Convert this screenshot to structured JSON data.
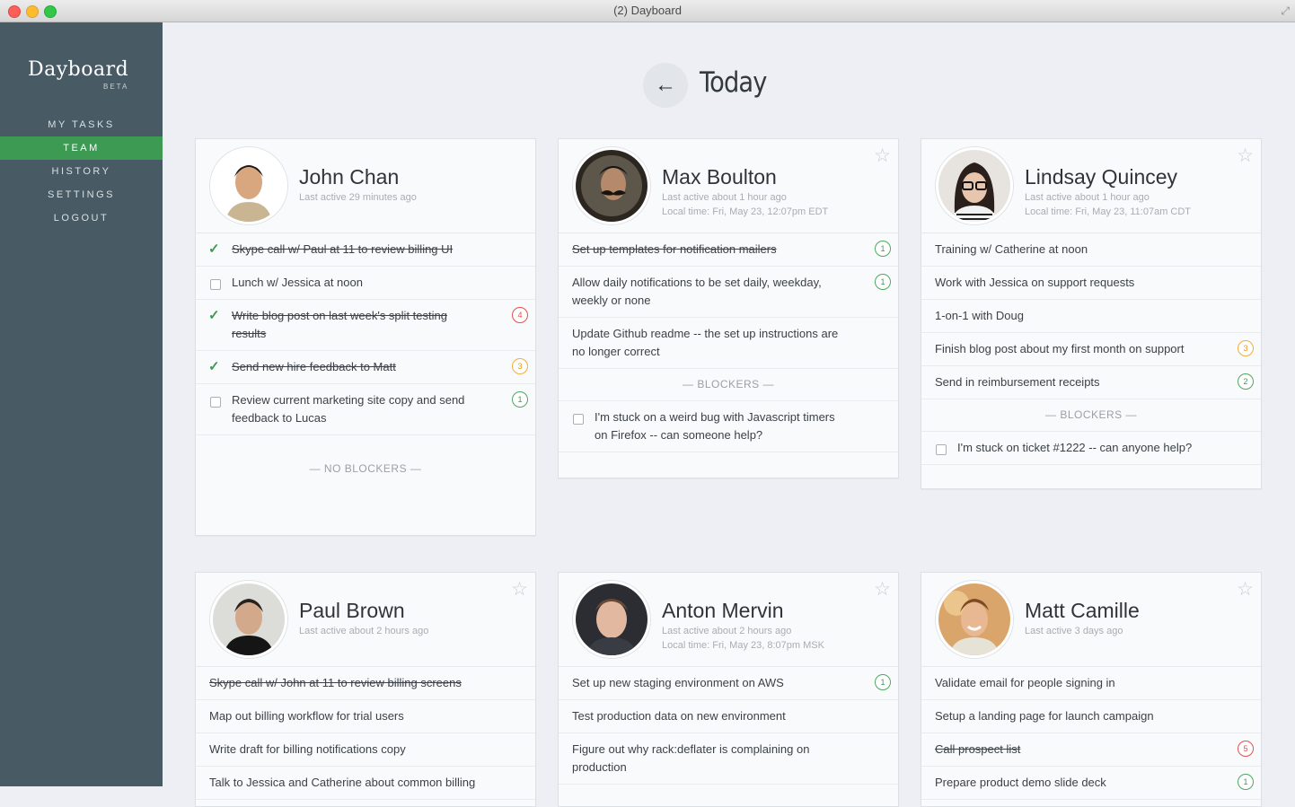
{
  "window": {
    "title": "(2) Dayboard"
  },
  "sidebar": {
    "logo": "Dayboard",
    "badge": "BETA",
    "items": [
      {
        "label": "MY TASKS"
      },
      {
        "label": "TEAM",
        "active": true
      },
      {
        "label": "HISTORY"
      },
      {
        "label": "SETTINGS"
      },
      {
        "label": "LOGOUT"
      }
    ]
  },
  "header": {
    "back_icon": "arrow-left-icon",
    "title": "Today"
  },
  "colors": {
    "accent_green": "#3d9a52",
    "sidebar_bg": "#485a63",
    "badge_red": "#e0524f",
    "badge_orange": "#f0ad3a"
  },
  "cards": [
    {
      "name": "John Chan",
      "last_active": "Last active 29 minutes ago",
      "local_time": "",
      "tasks": [
        {
          "text": "Skype call w/ Paul at 11 to review billing UI",
          "done": true
        },
        {
          "text": "Lunch w/ Jessica at noon",
          "done": false
        },
        {
          "text": "Write blog post on last week's split testing results",
          "done": true,
          "badge": "4"
        },
        {
          "text": "Send new hire feedback to Matt",
          "done": true,
          "badge": "3"
        },
        {
          "text": "Review current marketing site copy and send feedback to Lucas",
          "done": false,
          "badge": "1"
        }
      ],
      "blockers_label": "— NO BLOCKERS —"
    },
    {
      "name": "Max Boulton",
      "last_active": "Last active about 1 hour ago",
      "local_time": "Local time: Fri, May 23, 12:07pm EDT",
      "tasks": [
        {
          "text": "Set up templates for notification mailers",
          "badge": "1"
        },
        {
          "text": "Allow daily notifications to be set daily, weekday, weekly or none",
          "badge": "1"
        },
        {
          "text": "Update Github readme -- the set up instructions are no longer correct"
        }
      ],
      "blockers_label": "— BLOCKERS —",
      "blockers": [
        {
          "text": "I'm stuck on a weird bug with Javascript timers on Firefox -- can someone help?"
        }
      ]
    },
    {
      "name": "Lindsay Quincey",
      "last_active": "Last active about 1 hour ago",
      "local_time": "Local time: Fri, May 23, 11:07am CDT",
      "tasks": [
        {
          "text": "Training w/ Catherine at noon"
        },
        {
          "text": "Work with Jessica on support requests"
        },
        {
          "text": "1-on-1 with Doug"
        },
        {
          "text": "Finish blog post about my first month on support",
          "badge": "3"
        },
        {
          "text": "Send in reimbursement receipts",
          "badge": "2"
        }
      ],
      "blockers_label": "— BLOCKERS —",
      "blockers": [
        {
          "text": "I'm stuck on ticket #1222 -- can anyone help?"
        }
      ]
    },
    {
      "name": "Paul Brown",
      "last_active": "Last active about 2 hours ago",
      "local_time": "",
      "tasks": [
        {
          "text": "Skype call w/ John at 11 to review billing screens"
        },
        {
          "text": "Map out billing workflow for trial users"
        },
        {
          "text": "Write draft for billing notifications copy"
        },
        {
          "text": "Talk to Jessica and Catherine about common billing"
        }
      ]
    },
    {
      "name": "Anton Mervin",
      "last_active": "Last active about 2 hours ago",
      "local_time": "Local time: Fri, May 23, 8:07pm MSK",
      "tasks": [
        {
          "text": "Set up new staging environment on AWS",
          "badge": "1"
        },
        {
          "text": "Test production data on new environment"
        },
        {
          "text": "Figure out why rack:deflater is complaining on production"
        }
      ]
    },
    {
      "name": "Matt Camille",
      "last_active": "Last active 3 days ago",
      "local_time": "",
      "tasks": [
        {
          "text": "Validate email for people signing in"
        },
        {
          "text": "Setup a landing page for launch campaign"
        },
        {
          "text": "Call prospect list",
          "badge": "5"
        },
        {
          "text": "Prepare product demo slide deck",
          "badge": "1"
        }
      ]
    }
  ]
}
